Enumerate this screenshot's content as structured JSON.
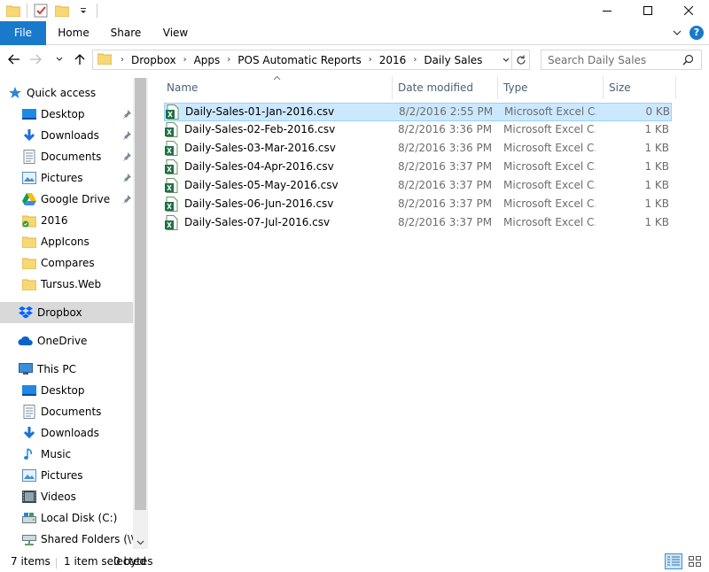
{
  "ribbon": {
    "tabs": [
      "File",
      "Home",
      "Share",
      "View"
    ]
  },
  "address": {
    "crumbs": [
      "Dropbox",
      "Apps",
      "POS Automatic Reports",
      "2016",
      "Daily Sales"
    ],
    "separator": "›"
  },
  "search": {
    "placeholder": "Search Daily Sales"
  },
  "sidebar": {
    "items": [
      {
        "label": "Quick access",
        "icon": "star-icon"
      },
      {
        "label": "Desktop",
        "icon": "desktop-icon",
        "pinned": true
      },
      {
        "label": "Downloads",
        "icon": "download-icon",
        "pinned": true
      },
      {
        "label": "Documents",
        "icon": "documents-icon",
        "pinned": true
      },
      {
        "label": "Pictures",
        "icon": "pictures-icon",
        "pinned": true
      },
      {
        "label": "Google Drive",
        "icon": "google-drive-icon",
        "pinned": true
      },
      {
        "label": "2016",
        "icon": "folder-sync-icon"
      },
      {
        "label": "AppIcons",
        "icon": "folder-icon"
      },
      {
        "label": "Compares",
        "icon": "folder-icon"
      },
      {
        "label": "Tursus.Web",
        "icon": "folder-icon"
      },
      {
        "label": "Dropbox",
        "icon": "dropbox-icon",
        "selected": true
      },
      {
        "label": "OneDrive",
        "icon": "onedrive-icon"
      },
      {
        "label": "This PC",
        "icon": "this-pc-icon"
      },
      {
        "label": "Desktop",
        "icon": "desktop-icon"
      },
      {
        "label": "Documents",
        "icon": "documents-icon"
      },
      {
        "label": "Downloads",
        "icon": "download-icon"
      },
      {
        "label": "Music",
        "icon": "music-icon"
      },
      {
        "label": "Pictures",
        "icon": "pictures-icon"
      },
      {
        "label": "Videos",
        "icon": "videos-icon"
      },
      {
        "label": "Local Disk (C:)",
        "icon": "disk-icon"
      },
      {
        "label": "Shared Folders (\\\\v",
        "icon": "network-drive-icon"
      }
    ]
  },
  "columns": {
    "name": "Name",
    "date": "Date modified",
    "type": "Type",
    "size": "Size"
  },
  "files": [
    {
      "name": "Daily-Sales-01-Jan-2016.csv",
      "date": "8/2/2016 2:55 PM",
      "type": "Microsoft Excel C...",
      "size": "0 KB",
      "selected": true
    },
    {
      "name": "Daily-Sales-02-Feb-2016.csv",
      "date": "8/2/2016 3:36 PM",
      "type": "Microsoft Excel C...",
      "size": "1 KB"
    },
    {
      "name": "Daily-Sales-03-Mar-2016.csv",
      "date": "8/2/2016 3:36 PM",
      "type": "Microsoft Excel C...",
      "size": "1 KB"
    },
    {
      "name": "Daily-Sales-04-Apr-2016.csv",
      "date": "8/2/2016 3:37 PM",
      "type": "Microsoft Excel C...",
      "size": "1 KB"
    },
    {
      "name": "Daily-Sales-05-May-2016.csv",
      "date": "8/2/2016 3:37 PM",
      "type": "Microsoft Excel C...",
      "size": "1 KB"
    },
    {
      "name": "Daily-Sales-06-Jun-2016.csv",
      "date": "8/2/2016 3:37 PM",
      "type": "Microsoft Excel C...",
      "size": "1 KB"
    },
    {
      "name": "Daily-Sales-07-Jul-2016.csv",
      "date": "8/2/2016 3:37 PM",
      "type": "Microsoft Excel C...",
      "size": "1 KB"
    }
  ],
  "status": {
    "count": "7 items",
    "selected": "1 item selected",
    "bytes": "0 bytes"
  },
  "colors": {
    "accent": "#1979ca",
    "selection_bg": "#cce8ff",
    "selection_border": "#99d1ff",
    "header_text": "#4c607a"
  }
}
